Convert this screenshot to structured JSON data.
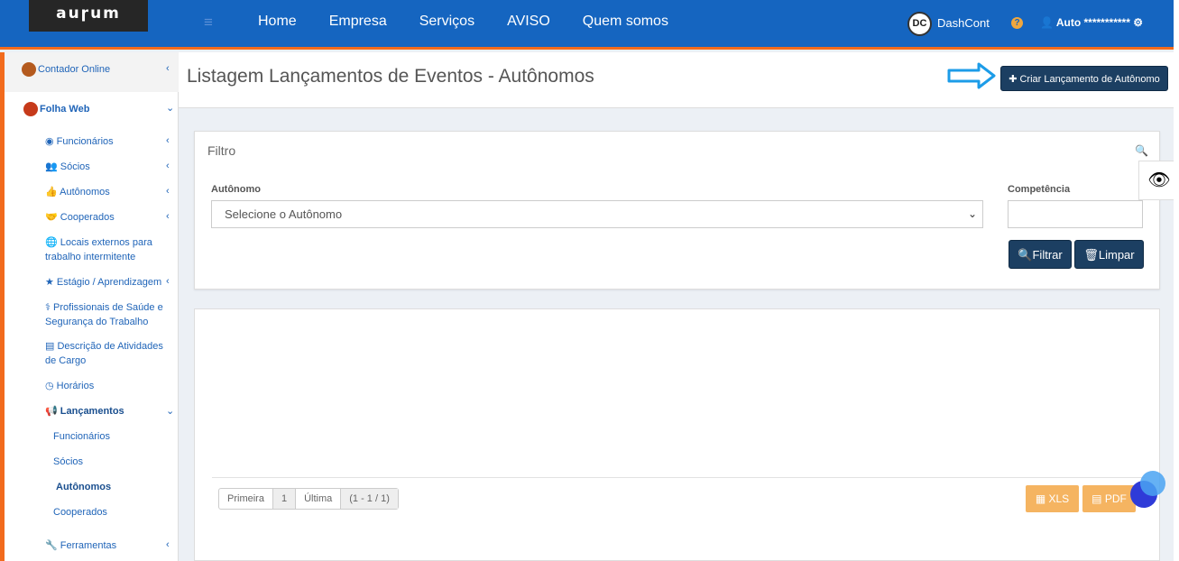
{
  "header": {
    "logo": "auɼum",
    "nav": [
      "Home",
      "Empresa",
      "Serviços",
      "AVISO",
      "Quem somos"
    ],
    "dc_logo": "DC",
    "dc_name": "DashCont",
    "help": "?",
    "user": "Auto ***********"
  },
  "sidebar": {
    "org": "Contador Online",
    "module": "Folha Web",
    "items": [
      {
        "label": "Funcionários"
      },
      {
        "label": "Sócios"
      },
      {
        "label": "Autônomos"
      },
      {
        "label": "Cooperados"
      },
      {
        "label": "Locais externos para trabalho intermitente"
      },
      {
        "label": "Estágio / Aprendizagem"
      },
      {
        "label": "Profissionais de Saúde e Segurança do Trabalho"
      },
      {
        "label": "Descrição de Atividades de Cargo"
      },
      {
        "label": "Horários"
      },
      {
        "label": "Lançamentos"
      },
      {
        "label": "Funcionários"
      },
      {
        "label": "Sócios"
      },
      {
        "label": "Autônomos"
      },
      {
        "label": "Cooperados"
      },
      {
        "label": "Ferramentas"
      }
    ]
  },
  "main": {
    "title": "Listagem Lançamentos de Eventos - Autônomos",
    "create_label": "Criar Lançamento de Autônomo",
    "filter": {
      "title": "Filtro",
      "autonomo_label": "Autônomo",
      "autonomo_value": "Selecione o Autônomo",
      "competencia_label": "Competência",
      "filtrar_label": "Filtrar",
      "limpar_label": "Limpar"
    },
    "pager": {
      "first": "Primeira",
      "page": "1",
      "last": "Última",
      "info": "(1 - 1 / 1)"
    },
    "export": {
      "xls": "XLS",
      "pdf": "PDF"
    }
  },
  "colors": {
    "header": "#1565c0",
    "accent": "#f26b1d",
    "button": "#1c3f62",
    "export": "#f5b461"
  }
}
